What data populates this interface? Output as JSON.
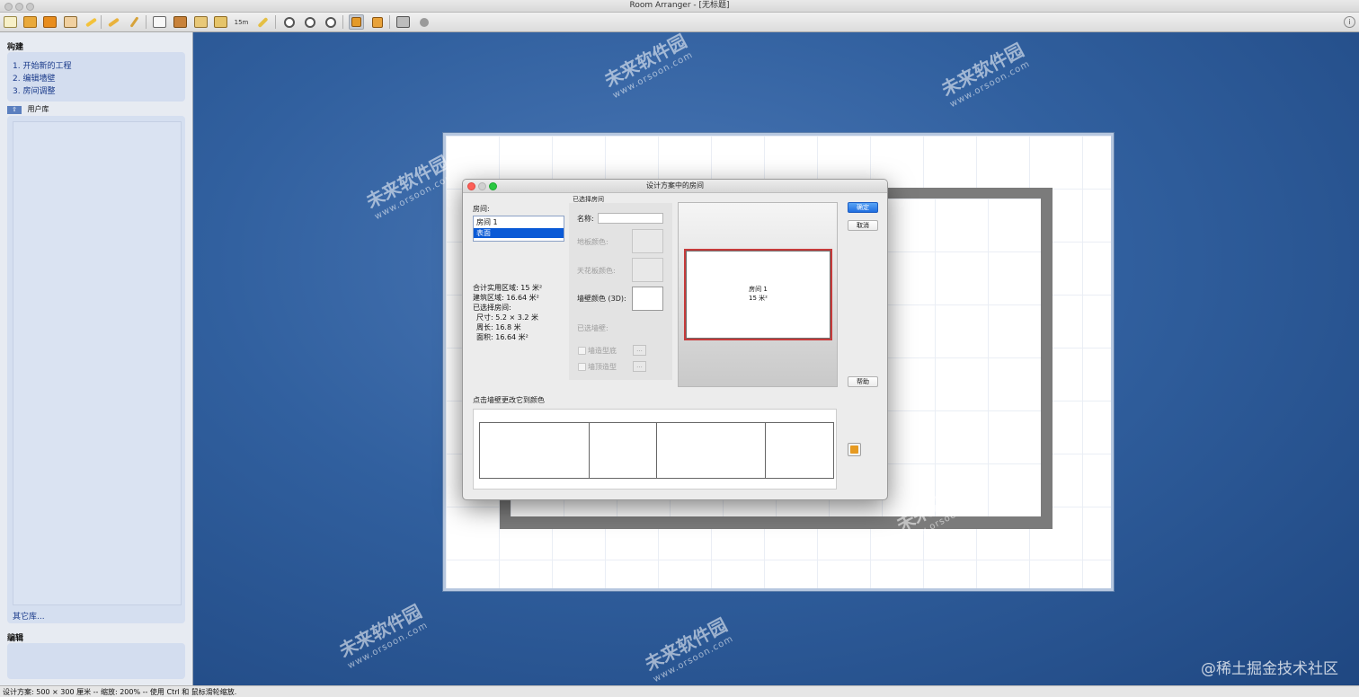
{
  "window": {
    "title": "Room Arranger - [无标题]"
  },
  "toolbar": {
    "icons": [
      "new-file-icon",
      "open-folder-icon",
      "save-icon",
      "print-icon",
      "pencil-icon",
      "eraser-icon",
      "brush-icon",
      "room-draw-icon",
      "wall-icon",
      "floor-icon",
      "copy-icon",
      "measure-icon",
      "ruler-icon",
      "zoom-fit-icon",
      "zoom-in-icon",
      "zoom-out-icon",
      "2d-view-icon",
      "3d-box-icon",
      "3d-house-icon",
      "3d-person-icon"
    ],
    "measure_label": "15m"
  },
  "left_panel": {
    "section1_title": "构建",
    "steps": [
      "1. 开始新的工程",
      "2. 编辑墙壁",
      "3. 房间调整"
    ],
    "library_title": "用户库",
    "more_libraries": "其它库...",
    "section2_title": "编辑"
  },
  "dialog": {
    "title": "设计方案中的房间",
    "rooms_label": "房间:",
    "rooms": [
      "房间 1",
      "表面"
    ],
    "selected_room_index": 1,
    "selected_room_header": "已选择房间",
    "name_label": "名称:",
    "name_value": "",
    "floor_color_label": "地板颜色:",
    "ceiling_color_label": "天花板颜色:",
    "wall_color_label": "墙壁颜色 (3D):",
    "selected_walls_label": "已选墙壁:",
    "wall_base_label": "墙造型底",
    "wall_top_label": "墙顶造型",
    "more_button": "...",
    "summary": {
      "usable_area": "合计实用区域: 15 米²",
      "building_area": "建筑区域: 16.64 米²",
      "selected_room": "已选择房间:",
      "size": "尺寸: 5.2 × 3.2 米",
      "perimeter": "周长: 16.8 米",
      "area": "面积: 16.64 米²"
    },
    "preview_room_name": "房间 1",
    "preview_room_area": "15 米²",
    "ok_button": "确定",
    "cancel_button": "取消",
    "help_button": "帮助",
    "wall_hint": "点击墙壁更改它到颜色"
  },
  "watermark": {
    "brand": "未来软件园",
    "url": "www.orsoon.com"
  },
  "statusbar": {
    "text": "设计方案: 500 × 300 厘米 -- 缩放: 200% -- 使用 Ctrl 和 鼠标滑轮缩放."
  },
  "credit": "@稀土掘金技术社区",
  "colors": {
    "canvas_blue": "#2d5590",
    "selection_blue": "#0a5ad6",
    "preview_border_red": "#c63b3b",
    "wall_gray": "#7b7b7b"
  }
}
